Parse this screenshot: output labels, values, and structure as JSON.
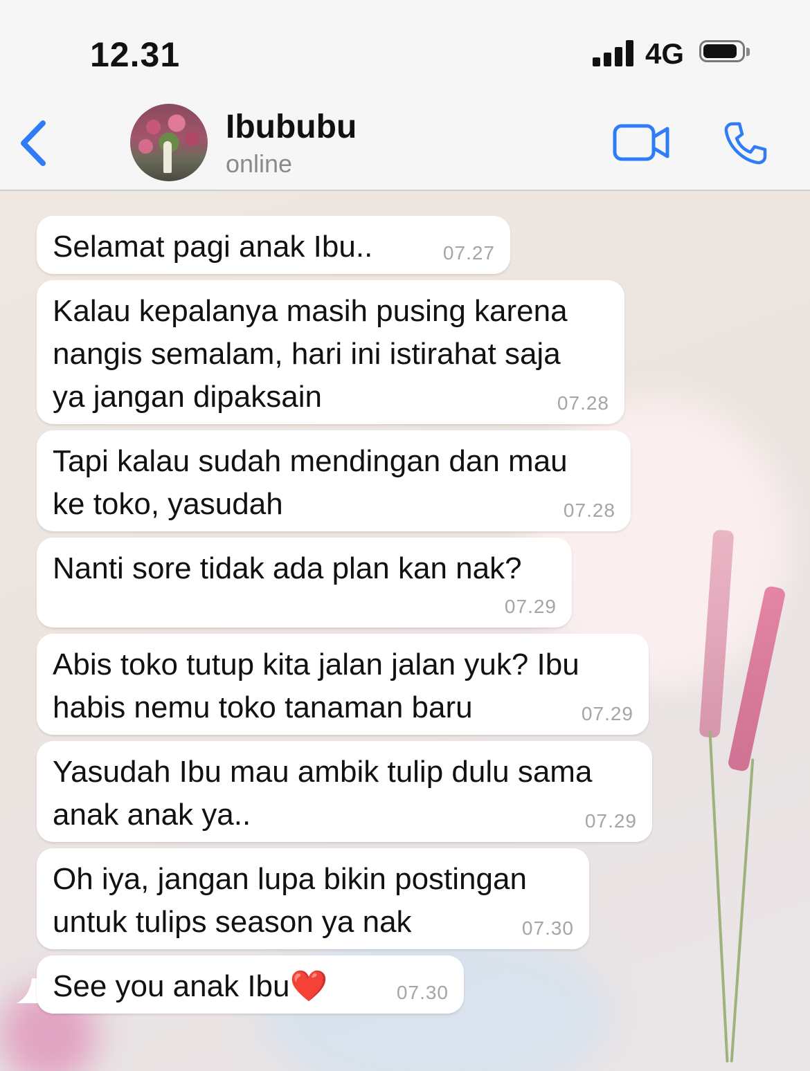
{
  "status_bar": {
    "time": "12.31",
    "network": "4G"
  },
  "header": {
    "contact_name": "Ibububu",
    "status": "online"
  },
  "messages": [
    {
      "text": "Selamat pagi anak Ibu..",
      "time": "07.27"
    },
    {
      "text": "Kalau kepalanya masih pusing karena\nnangis semalam, hari ini istirahat saja\nya jangan dipaksain",
      "time": "07.28"
    },
    {
      "text": "Tapi kalau sudah mendingan dan mau\nke toko, yasudah",
      "time": "07.28"
    },
    {
      "text": "Nanti sore tidak ada plan kan nak?",
      "time": "07.29"
    },
    {
      "text": "Abis toko tutup kita jalan jalan yuk? Ibu\nhabis nemu toko tanaman baru",
      "time": "07.29"
    },
    {
      "text": "Yasudah Ibu mau ambik tulip dulu sama\nanak anak ya..",
      "time": "07.29"
    },
    {
      "text": "Oh iya, jangan lupa bikin postingan\nuntuk tulips season ya nak",
      "time": "07.30"
    },
    {
      "text": "See you anak Ibu❤️",
      "time": "07.30"
    }
  ],
  "colors": {
    "accent": "#2f7cf6",
    "bubble": "#ffffff",
    "timestamp": "#a5a5a5"
  },
  "icons": {
    "back": "chevron-left-icon",
    "video": "video-camera-icon",
    "call": "phone-icon"
  }
}
